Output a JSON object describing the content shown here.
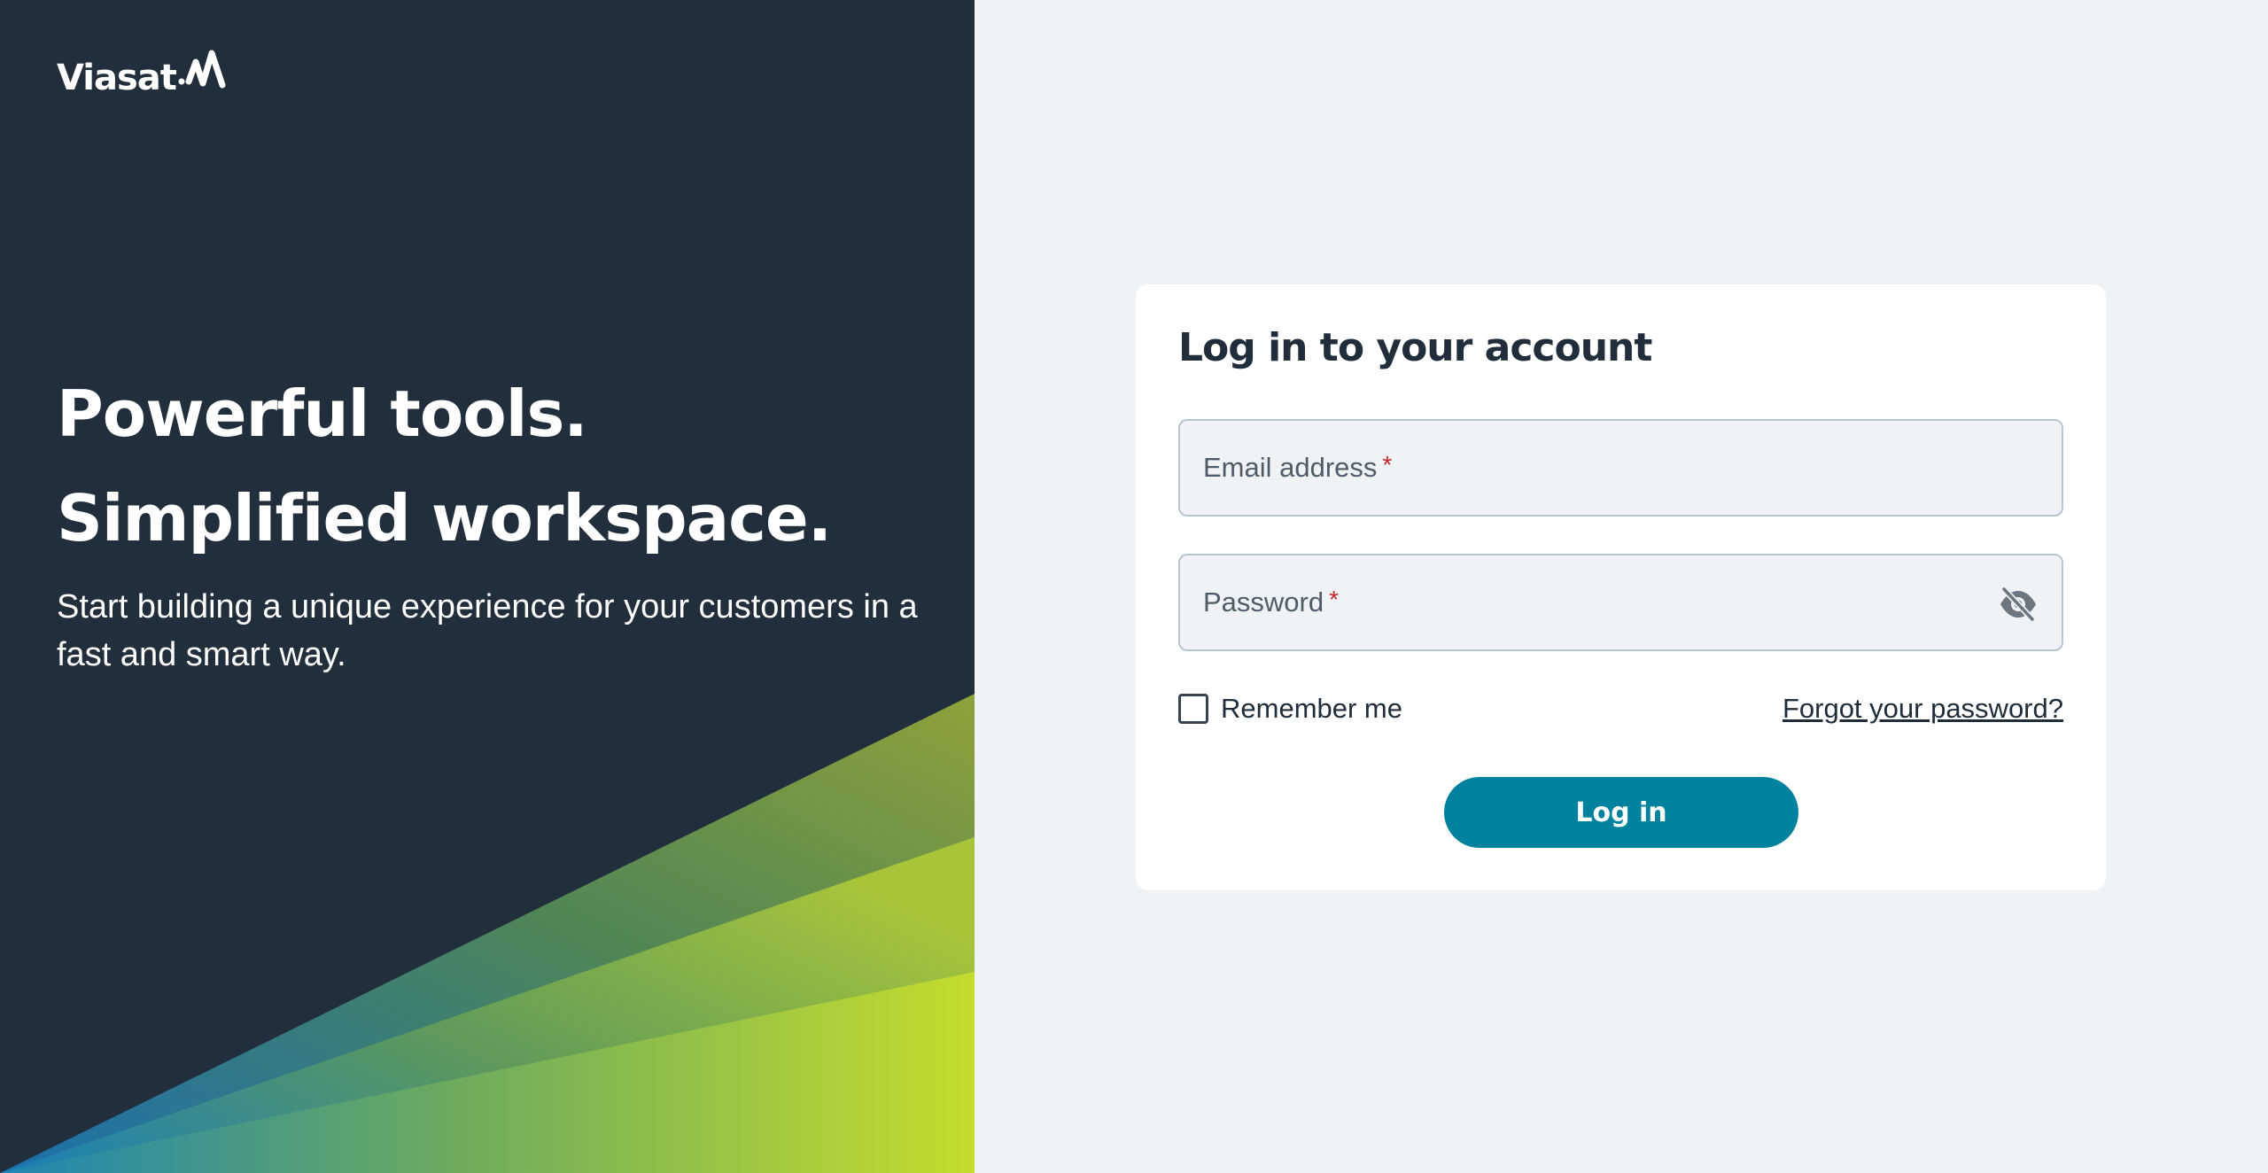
{
  "brand": {
    "name": "Viasat",
    "logo_icon": "viasat-wave-logo"
  },
  "hero": {
    "line1": "Powerful tools.",
    "line2": "Simplified workspace.",
    "subtitle": "Start building a unique experience for your customers in a fast and smart way."
  },
  "login": {
    "title": "Log in to your account",
    "email_label": "Email address",
    "password_label": "Password",
    "required_marker": "*",
    "password_toggle_icon": "eye-slash-icon",
    "remember_label": "Remember me",
    "remember_checked": false,
    "forgot_label": "Forgot your password?",
    "submit_label": "Log in"
  },
  "colors": {
    "left_background": "#212e3b",
    "right_background": "#f0f3f6",
    "accent": "#00819d",
    "required": "#c0262d",
    "gradient_start": "#1a7fb8",
    "gradient_end": "#c4dc2c"
  }
}
